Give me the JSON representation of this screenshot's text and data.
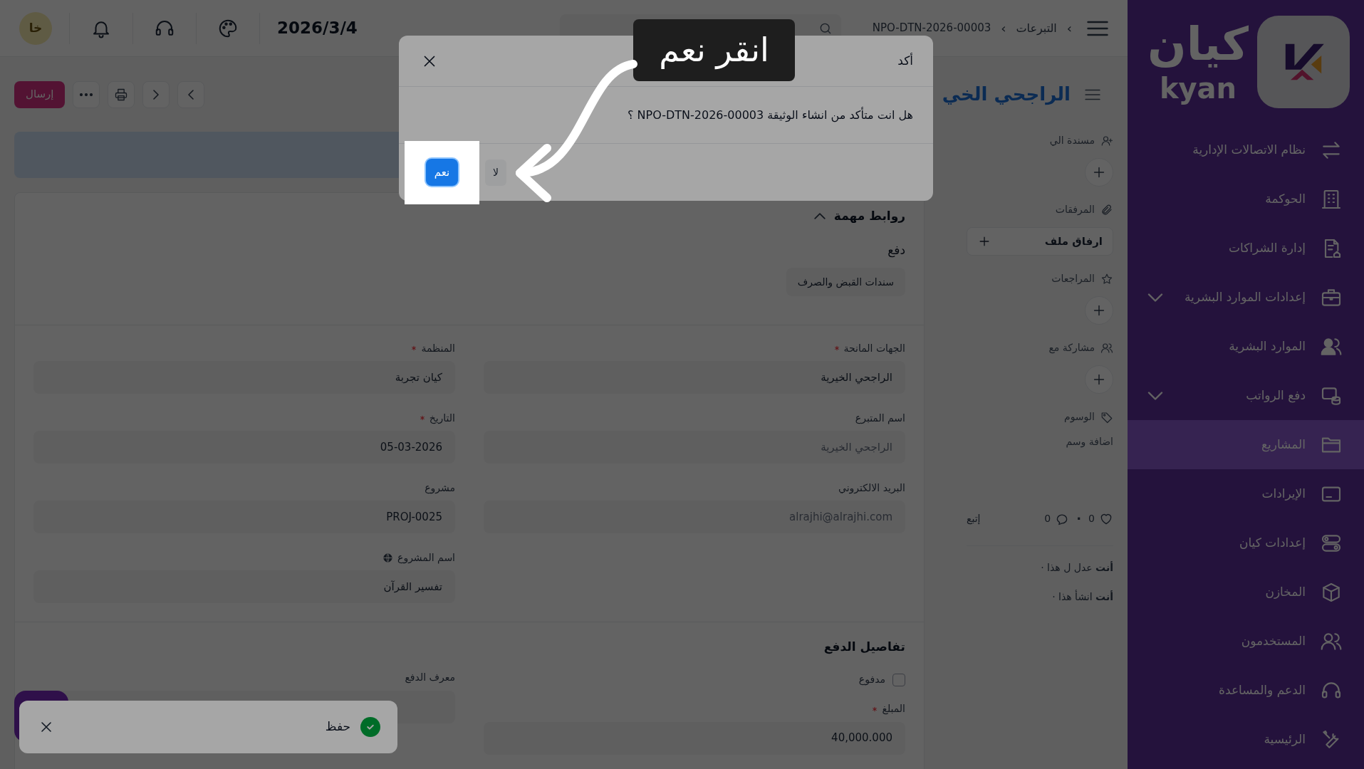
{
  "sidebar": {
    "logo": {
      "text": "كيان",
      "subtext": "kyan"
    },
    "items": [
      {
        "label": "نظام الاتصالات الإدارية",
        "expandable": false,
        "selected": false
      },
      {
        "label": "الحوكمة",
        "expandable": false,
        "selected": false
      },
      {
        "label": "إدارة الشراكات",
        "expandable": false,
        "selected": false
      },
      {
        "label": "إعدادات الموارد البشرية",
        "expandable": true,
        "selected": false
      },
      {
        "label": "الموارد البشرية",
        "expandable": false,
        "selected": false
      },
      {
        "label": "دفع الرواتب",
        "expandable": true,
        "selected": false
      },
      {
        "label": "المشاريع",
        "expandable": false,
        "selected": true
      },
      {
        "label": "الإيرادات",
        "expandable": false,
        "selected": false
      },
      {
        "label": "إعدادات كيان",
        "expandable": false,
        "selected": false
      },
      {
        "label": "المخازن",
        "expandable": false,
        "selected": false
      },
      {
        "label": "المستخدمون",
        "expandable": false,
        "selected": false
      },
      {
        "label": "الدعم والمساعدة",
        "expandable": false,
        "selected": false
      },
      {
        "label": "الرئيسية",
        "expandable": false,
        "selected": false
      }
    ]
  },
  "header": {
    "breadcrumb": [
      {
        "separator": "›",
        "label": "التبرعات"
      },
      {
        "separator": "›",
        "label": "NPO-DTN-2026-00003"
      }
    ],
    "date": "2026/3/4",
    "avatar": "خا"
  },
  "page": {
    "title": "الراجحي الخي",
    "submit": "إرسال"
  },
  "side_panel": {
    "sections": [
      {
        "kind": "add",
        "label": "مسندة الي"
      },
      {
        "kind": "attach",
        "label": "المرفقات",
        "button": "ارفاق ملف"
      },
      {
        "kind": "add",
        "label": "المراجعات"
      },
      {
        "kind": "add",
        "label": "مشاركة مع"
      },
      {
        "kind": "tags",
        "label": "الوسوم",
        "link": "اضافة وسم"
      }
    ],
    "likes": "0",
    "separator": "·",
    "comments": "0",
    "follow": "إتبع",
    "activity": [
      "**أنت** عدل ل هذا ·",
      "**أنت** انشأ هذا ·"
    ]
  },
  "links_section": {
    "title": "روابط مهمة",
    "expanded": true,
    "group": "دفع",
    "chips": [
      "سندات القبض والصرف"
    ]
  },
  "details_section": {
    "columns": [
      [
        {
          "label": "الجهات المانحة",
          "required": true,
          "value": "الراجحي الخيرية",
          "read_only": false,
          "kind": "plain"
        },
        {
          "label": "اسم المتبرع",
          "required": false,
          "value": "الراجحي الخيرية",
          "read_only": true,
          "kind": "plain"
        },
        {
          "label": "البريد الالكتروني",
          "required": false,
          "value": "alrajhi@alrajhi.com",
          "read_only": true,
          "kind": "plain"
        }
      ],
      [
        {
          "label": "المنظمة",
          "required": true,
          "value": "كيان تجربة",
          "read_only": false,
          "kind": "plain"
        },
        {
          "label": "التاريخ",
          "required": true,
          "value": "05-03-2026",
          "read_only": false,
          "kind": "plain"
        },
        {
          "label": "مشروع",
          "required": false,
          "value": "PROJ-0025",
          "read_only": false,
          "kind": "plain"
        },
        {
          "label": "اسم المشروع",
          "required": false,
          "value": "تفسير القرآن",
          "read_only": false,
          "kind": "global"
        }
      ]
    ]
  },
  "payment_section": {
    "title": "تفاصيل الدفع",
    "columns": [
      [
        {
          "kind": "checkbox",
          "label": "مدفوع",
          "checked": false
        },
        {
          "kind": "input",
          "label": "المبلغ",
          "required": true,
          "value": "40,000.000"
        }
      ],
      [
        {
          "kind": "input",
          "label": "معرف الدفع",
          "required": false
        }
      ]
    ]
  },
  "toast": {
    "message": "حفظ"
  },
  "modal": {
    "title": "أكد",
    "message": "هل انت متأكد من انشاء الوثيقة NPO-DTN-2026-00003 ؟",
    "cancel": "لا",
    "confirm": "نعم"
  },
  "annotation": {
    "text": "انقر نعم"
  }
}
